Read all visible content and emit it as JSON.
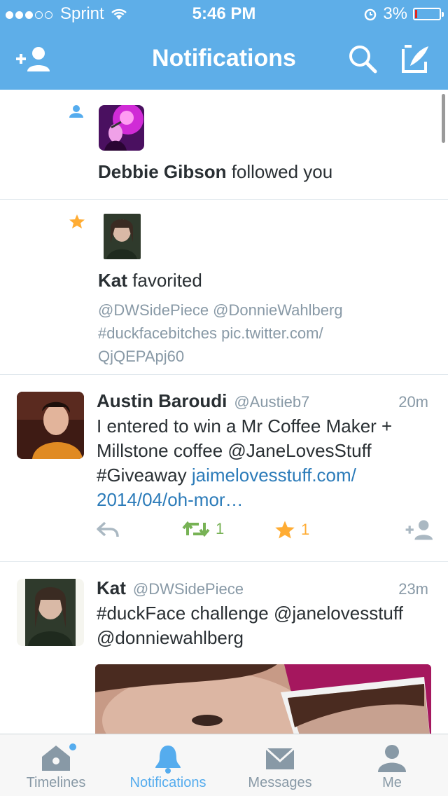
{
  "status_bar": {
    "carrier": "Sprint",
    "time": "5:46 PM",
    "battery": "3%"
  },
  "header": {
    "title": "Notifications",
    "add_user_icon": "add-user-icon",
    "search_icon": "search-icon",
    "compose_icon": "compose-icon"
  },
  "notifications": [
    {
      "type": "follow",
      "icon": "person-icon",
      "name": "Debbie Gibson",
      "action": " followed you"
    },
    {
      "type": "favorite",
      "icon": "star-icon",
      "name": "Kat",
      "action": " favorited",
      "tweet_line1": "@DWSidePiece @DonnieWahlberg",
      "tweet_line2": "#duckfacebitches pic.twitter.com/",
      "tweet_line3": "QjQEPApj60"
    }
  ],
  "tweets": [
    {
      "name": "Austin Baroudi",
      "handle": "@Austieb7",
      "time": "20m",
      "line1": "I entered to win a Mr Coffee Maker +",
      "line2": "Millstone coffee @JaneLovesStuff",
      "line3": "#Giveaway ",
      "link1": "jaimelovesstuff.com/",
      "link2": "2014/04/oh-mor…",
      "retweets": "1",
      "favorites": "1"
    },
    {
      "name": "Kat",
      "handle": "@DWSidePiece",
      "time": "23m",
      "line1": "#duckFace challenge @janelovesstuff",
      "line2": "@donniewahlberg"
    }
  ],
  "tabs": [
    {
      "label": "Timelines",
      "icon": "home-icon"
    },
    {
      "label": "Notifications",
      "icon": "bell-icon"
    },
    {
      "label": "Messages",
      "icon": "envelope-icon"
    },
    {
      "label": "Me",
      "icon": "profile-icon"
    }
  ],
  "colors": {
    "header": "#5eaee8",
    "link": "#2b7bb9",
    "retweet": "#77b255",
    "favorite": "#ffac33",
    "muted": "#8899a6",
    "active_tab": "#55acee"
  }
}
